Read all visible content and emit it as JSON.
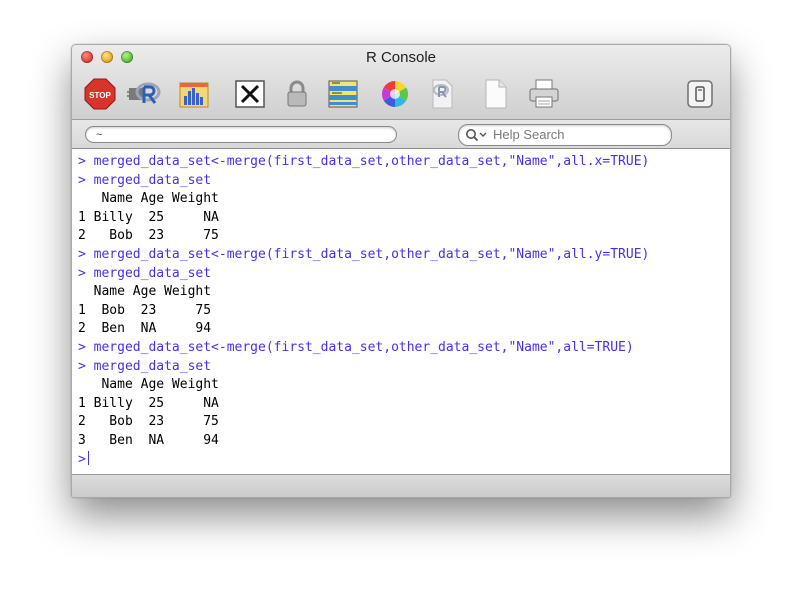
{
  "window": {
    "title": "R Console"
  },
  "search": {
    "path_value": "~",
    "help_placeholder": "Help Search"
  },
  "toolbar": {
    "stop_label": "STOP",
    "colors": {
      "stop": "#d9342b",
      "r_blue": "#2e5fb5",
      "accent": "#4830e8"
    }
  },
  "console": {
    "lines": [
      {
        "kind": "in",
        "text": "> merged_data_set<-merge(first_data_set,other_data_set,\"Name\",all.x=TRUE)"
      },
      {
        "kind": "in",
        "text": "> merged_data_set"
      },
      {
        "kind": "out",
        "text": "   Name Age Weight"
      },
      {
        "kind": "out",
        "text": "1 Billy  25     NA"
      },
      {
        "kind": "out",
        "text": "2   Bob  23     75"
      },
      {
        "kind": "in",
        "text": "> merged_data_set<-merge(first_data_set,other_data_set,\"Name\",all.y=TRUE)"
      },
      {
        "kind": "in",
        "text": "> merged_data_set"
      },
      {
        "kind": "out",
        "text": "  Name Age Weight"
      },
      {
        "kind": "out",
        "text": "1  Bob  23     75"
      },
      {
        "kind": "out",
        "text": "2  Ben  NA     94"
      },
      {
        "kind": "in",
        "text": "> merged_data_set<-merge(first_data_set,other_data_set,\"Name\",all=TRUE)"
      },
      {
        "kind": "in",
        "text": "> merged_data_set"
      },
      {
        "kind": "out",
        "text": "   Name Age Weight"
      },
      {
        "kind": "out",
        "text": "1 Billy  25     NA"
      },
      {
        "kind": "out",
        "text": "2   Bob  23     75"
      },
      {
        "kind": "out",
        "text": "3   Ben  NA     94"
      }
    ],
    "prompt": ">"
  }
}
